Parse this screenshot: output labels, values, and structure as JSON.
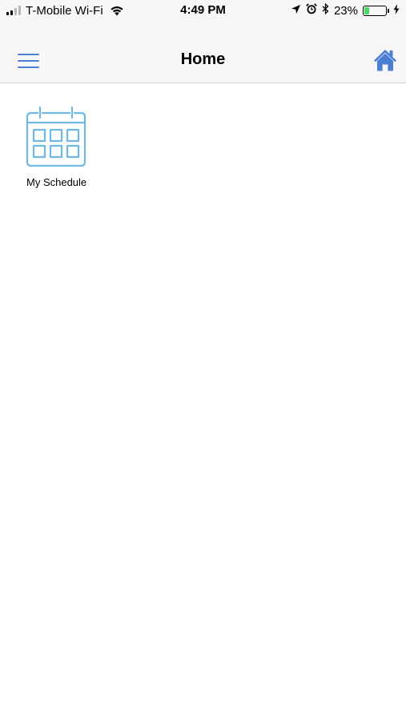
{
  "status_bar": {
    "carrier": "T-Mobile Wi-Fi",
    "time": "4:49 PM",
    "battery_percent": "23%",
    "battery_level": 0.23,
    "icons": [
      "signal-icon",
      "wifi-icon",
      "location-icon",
      "alarm-icon",
      "bluetooth-icon",
      "battery-icon",
      "charging-icon"
    ]
  },
  "nav": {
    "title": "Home",
    "left_icon": "hamburger-menu-icon",
    "right_icon": "home-icon"
  },
  "tiles": [
    {
      "label": "My Schedule",
      "icon": "calendar-icon"
    }
  ],
  "colors": {
    "accent": "#4a7fd6",
    "calendar_icon": "#6fb9e6",
    "battery": "#4cd964",
    "nav_background": "#f7f7f7"
  }
}
